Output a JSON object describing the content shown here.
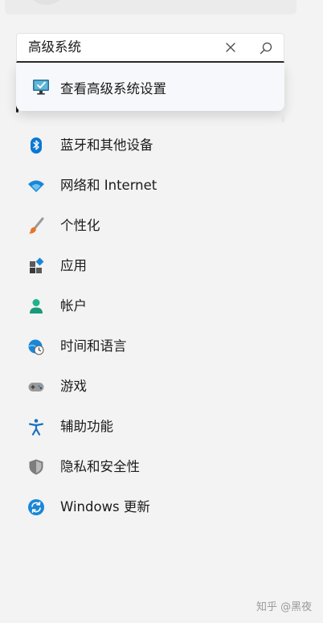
{
  "search": {
    "query": "高级系统"
  },
  "dropdown": {
    "suggestion": "查看高级系统设置",
    "icon": "system-monitor-icon"
  },
  "nav": {
    "items": [
      {
        "label": "蓝牙和其他设备",
        "icon": "bluetooth-icon",
        "color": "#0a78d4"
      },
      {
        "label": "网络和 Internet",
        "icon": "wifi-icon",
        "color": "#1a86d8"
      },
      {
        "label": "个性化",
        "icon": "paintbrush-icon",
        "color": "#e8742a"
      },
      {
        "label": "应用",
        "icon": "apps-icon",
        "color": "#4a4a4a"
      },
      {
        "label": "帐户",
        "icon": "account-icon",
        "color": "#21b28c"
      },
      {
        "label": "时间和语言",
        "icon": "globe-clock-icon",
        "color": "#1a86d8"
      },
      {
        "label": "游戏",
        "icon": "gamepad-icon",
        "color": "#8a8a8a"
      },
      {
        "label": "辅助功能",
        "icon": "accessibility-icon",
        "color": "#1a6fbf"
      },
      {
        "label": "隐私和安全性",
        "icon": "shield-icon",
        "color": "#8c8c8c"
      },
      {
        "label": "Windows 更新",
        "icon": "update-icon",
        "color": "#1a86d8"
      }
    ]
  },
  "watermark": "知乎 @黑夜"
}
